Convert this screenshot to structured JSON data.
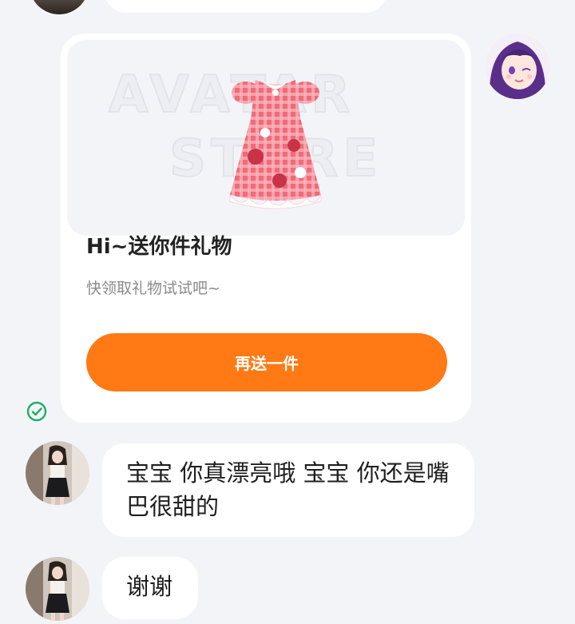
{
  "gift_card": {
    "banner_text_line1": "AVATAR",
    "banner_text_line2": "STORE",
    "title": "Hi~送你件礼物",
    "subtitle": "快领取礼物试试吧~",
    "button_label": "再送一件",
    "accent_color": "#ff7a14"
  },
  "messages": [
    {
      "sender": "other",
      "text": "宝宝 你真漂亮哦 宝宝 你还是嘴巴很甜的"
    },
    {
      "sender": "other",
      "text": "谢谢"
    }
  ],
  "status": {
    "sent_icon": "check-circle-icon",
    "sent_color": "#1fae66"
  }
}
